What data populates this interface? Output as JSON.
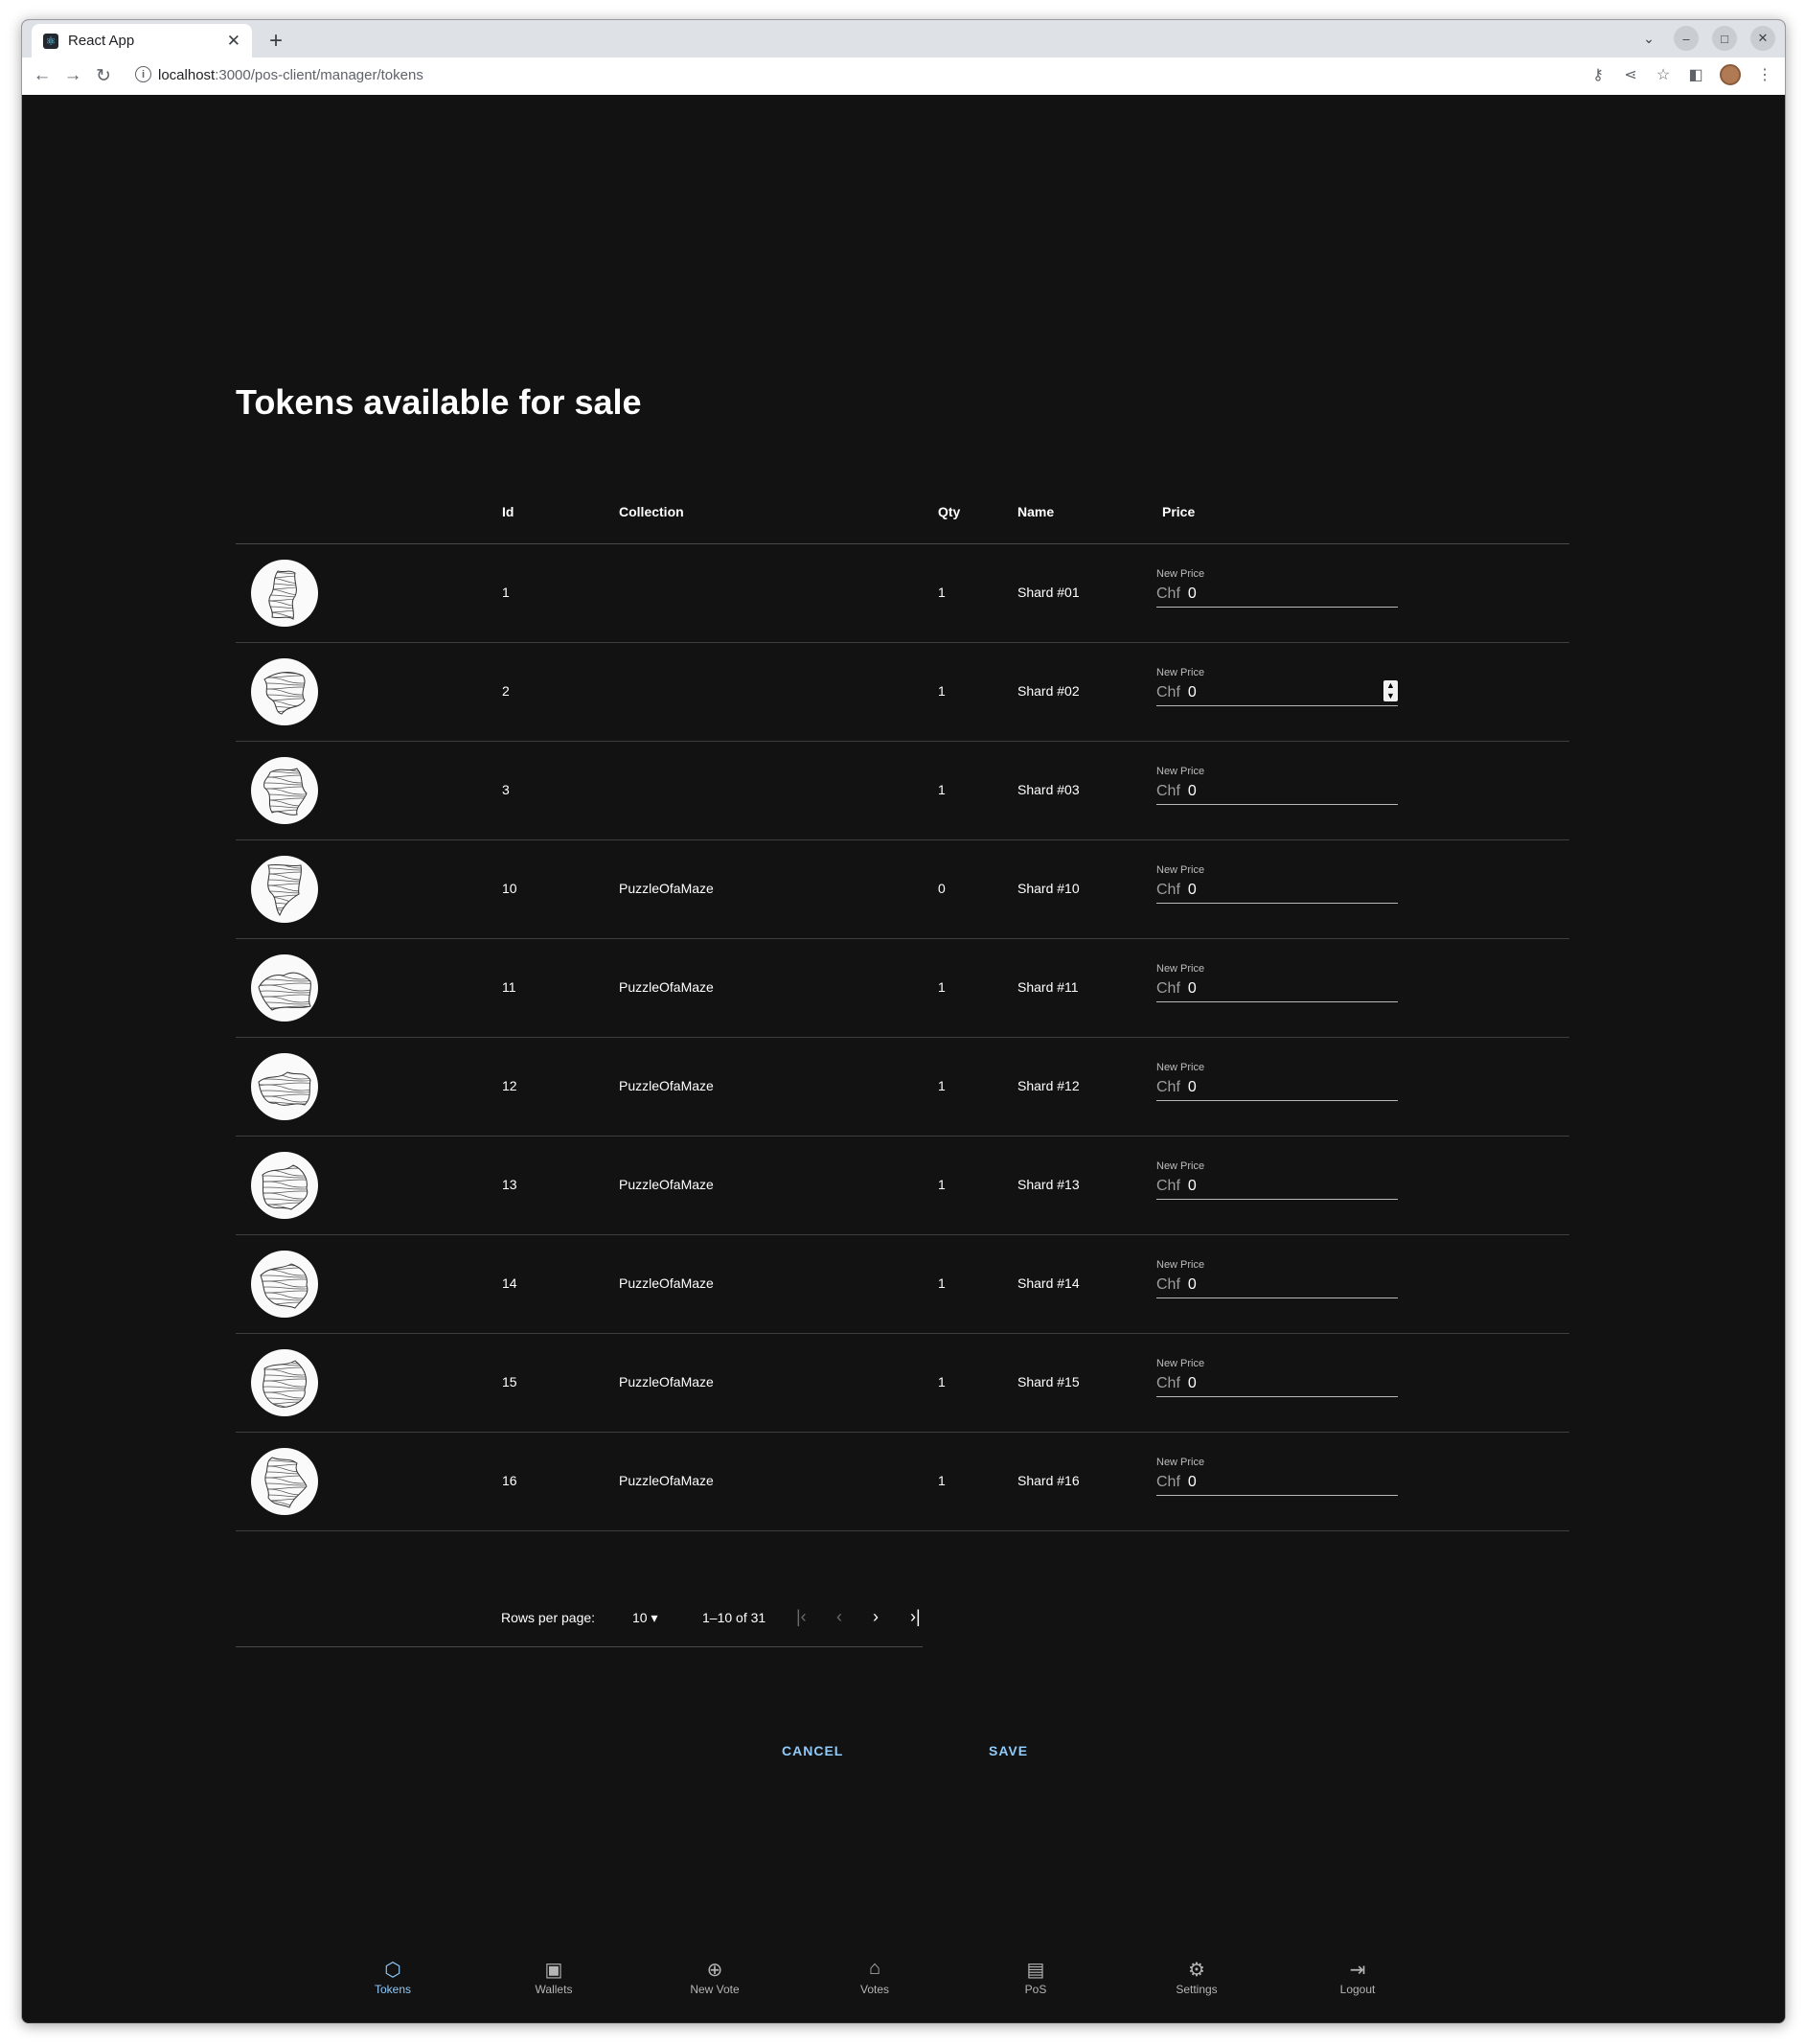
{
  "browser": {
    "tab_title": "React App",
    "url_host": "localhost",
    "url_path": ":3000/pos-client/manager/tokens"
  },
  "page": {
    "title": "Tokens available for sale"
  },
  "table": {
    "columns": [
      "Id",
      "Collection",
      "Qty",
      "Name",
      "Price"
    ],
    "price_label": "New Price",
    "price_prefix": "Chf",
    "rows": [
      {
        "id": "1",
        "collection": "",
        "qty": "1",
        "name": "Shard #01",
        "price": "0"
      },
      {
        "id": "2",
        "collection": "",
        "qty": "1",
        "name": "Shard #02",
        "price": "0"
      },
      {
        "id": "3",
        "collection": "",
        "qty": "1",
        "name": "Shard #03",
        "price": "0"
      },
      {
        "id": "10",
        "collection": "PuzzleOfaMaze",
        "qty": "0",
        "name": "Shard #10",
        "price": "0"
      },
      {
        "id": "11",
        "collection": "PuzzleOfaMaze",
        "qty": "1",
        "name": "Shard #11",
        "price": "0"
      },
      {
        "id": "12",
        "collection": "PuzzleOfaMaze",
        "qty": "1",
        "name": "Shard #12",
        "price": "0"
      },
      {
        "id": "13",
        "collection": "PuzzleOfaMaze",
        "qty": "1",
        "name": "Shard #13",
        "price": "0"
      },
      {
        "id": "14",
        "collection": "PuzzleOfaMaze",
        "qty": "1",
        "name": "Shard #14",
        "price": "0"
      },
      {
        "id": "15",
        "collection": "PuzzleOfaMaze",
        "qty": "1",
        "name": "Shard #15",
        "price": "0"
      },
      {
        "id": "16",
        "collection": "PuzzleOfaMaze",
        "qty": "1",
        "name": "Shard #16",
        "price": "0"
      }
    ]
  },
  "pagination": {
    "rows_per_page_label": "Rows per page:",
    "rows_per_page": "10",
    "range": "1–10 of 31"
  },
  "actions": {
    "cancel": "CANCEL",
    "save": "SAVE"
  },
  "bottom_nav": [
    {
      "label": "Tokens",
      "icon": "cube-icon",
      "active": true
    },
    {
      "label": "Wallets",
      "icon": "wallet-icon",
      "active": false
    },
    {
      "label": "New Vote",
      "icon": "add-circle-icon",
      "active": false
    },
    {
      "label": "Votes",
      "icon": "ballot-icon",
      "active": false
    },
    {
      "label": "PoS",
      "icon": "point-of-sale-icon",
      "active": false
    },
    {
      "label": "Settings",
      "icon": "gear-icon",
      "active": false
    },
    {
      "label": "Logout",
      "icon": "logout-icon",
      "active": false
    }
  ],
  "colors": {
    "background": "#121212",
    "accent": "#90caf9"
  }
}
